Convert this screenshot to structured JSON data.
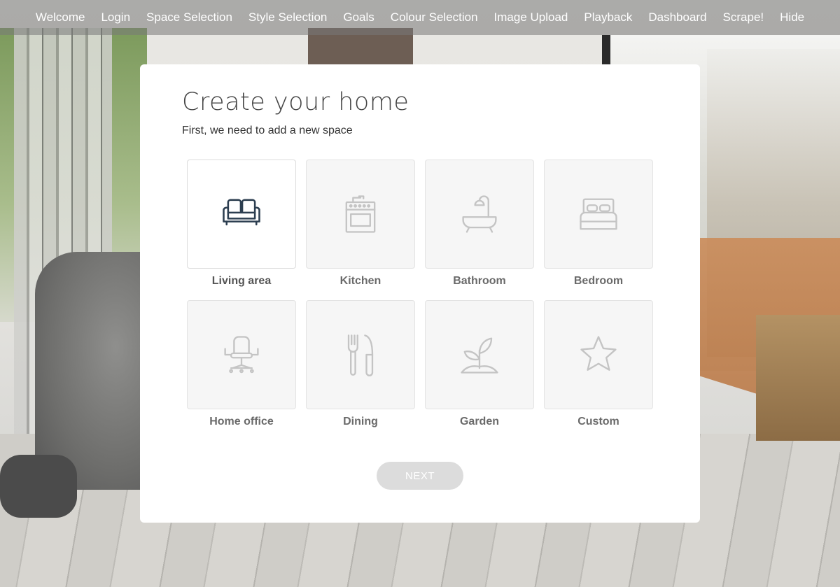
{
  "nav": {
    "items": [
      "Welcome",
      "Login",
      "Space Selection",
      "Style Selection",
      "Goals",
      "Colour Selection",
      "Image Upload",
      "Playback",
      "Dashboard",
      "Scrape!",
      "Hide"
    ]
  },
  "card": {
    "title": "Create your home",
    "subtitle": "First, we need to add a new space",
    "next_label": "NEXT"
  },
  "spaces": [
    {
      "label": "Living area",
      "icon": "sofa-icon",
      "selected": true
    },
    {
      "label": "Kitchen",
      "icon": "stove-icon",
      "selected": false
    },
    {
      "label": "Bathroom",
      "icon": "bathtub-icon",
      "selected": false
    },
    {
      "label": "Bedroom",
      "icon": "bed-icon",
      "selected": false
    },
    {
      "label": "Home office",
      "icon": "office-chair-icon",
      "selected": false
    },
    {
      "label": "Dining",
      "icon": "fork-knife-icon",
      "selected": false
    },
    {
      "label": "Garden",
      "icon": "plant-icon",
      "selected": false
    },
    {
      "label": "Custom",
      "icon": "star-icon",
      "selected": false
    }
  ],
  "colors": {
    "selected_icon": "#2c3e50",
    "unselected_icon": "#c4c4c4",
    "next_button": "#dcdcdc"
  }
}
